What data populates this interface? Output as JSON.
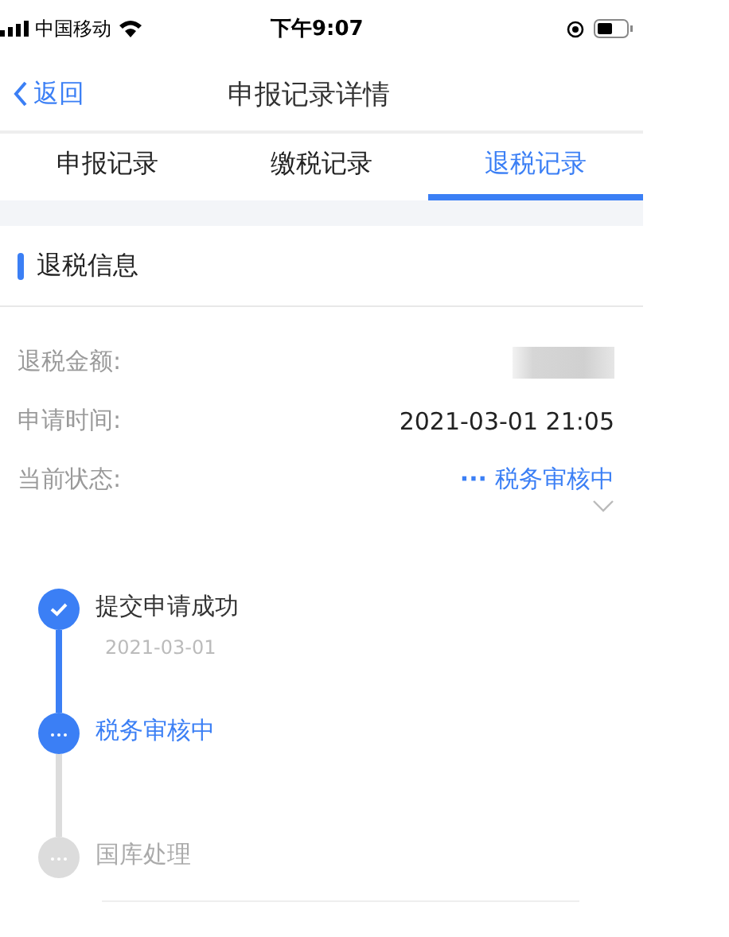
{
  "status_bar": {
    "carrier": "中国移动",
    "time": "下午9:07"
  },
  "nav": {
    "back": "返回",
    "title": "申报记录详情"
  },
  "tabs": [
    {
      "label": "申报记录",
      "selected": false
    },
    {
      "label": "缴税记录",
      "selected": false
    },
    {
      "label": "退税记录",
      "selected": true
    }
  ],
  "section": {
    "title": "退税信息"
  },
  "fields": [
    {
      "kind": "redacted",
      "label": "退税金额:"
    },
    {
      "kind": "text",
      "label": "申请时间:",
      "value": "2021-03-01 21:05"
    },
    {
      "kind": "status",
      "label": "当前状态:",
      "dots": "···",
      "value": "税务审核中"
    }
  ],
  "timeline": [
    {
      "kind": "done",
      "title": "提交申请成功",
      "date": "2021-03-01"
    },
    {
      "kind": "current",
      "title": "税务审核中"
    },
    {
      "kind": "pending",
      "title": "国库处理"
    }
  ]
}
